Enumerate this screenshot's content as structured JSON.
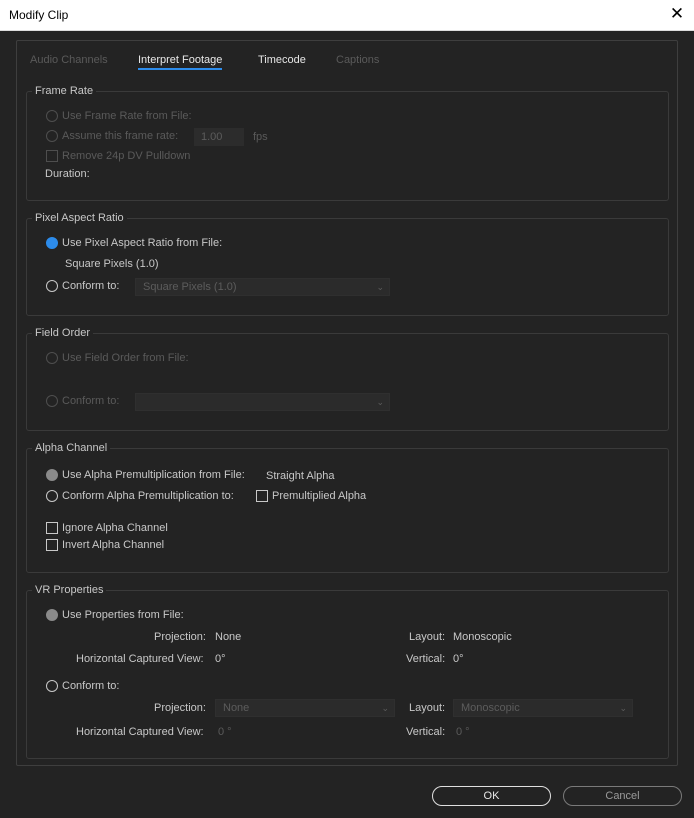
{
  "window": {
    "title": "Modify Clip",
    "close_glyph": "✕"
  },
  "tabs": [
    "Audio Channels",
    "Interpret Footage",
    "Timecode",
    "Captions"
  ],
  "frame_rate": {
    "title": "Frame Rate",
    "use_from_file": "Use Frame Rate from File:",
    "assume_label": "Assume this frame rate:",
    "assume_value": "1.00",
    "fps": "fps",
    "remove_pulldown": "Remove 24p DV Pulldown",
    "duration": "Duration:"
  },
  "pixel_aspect": {
    "title": "Pixel Aspect Ratio",
    "use_from_file": "Use Pixel Aspect Ratio from File:",
    "file_value": "Square Pixels (1.0)",
    "conform_to": "Conform to:",
    "conform_value": "Square Pixels (1.0)"
  },
  "field_order": {
    "title": "Field Order",
    "use_from_file": "Use Field Order from File:",
    "conform_to": "Conform to:",
    "conform_value": ""
  },
  "alpha": {
    "title": "Alpha Channel",
    "use_premult": "Use Alpha Premultiplication from File:",
    "premult_value": "Straight Alpha",
    "conform_premult": "Conform Alpha Premultiplication to:",
    "premultiplied": "Premultiplied Alpha",
    "ignore": "Ignore Alpha Channel",
    "invert": "Invert Alpha Channel"
  },
  "vr": {
    "title": "VR Properties",
    "use_from_file": "Use Properties from File:",
    "projection_label": "Projection:",
    "projection_value": "None",
    "layout_label": "Layout:",
    "layout_value": "Monoscopic",
    "hview_label": "Horizontal Captured View:",
    "hview_value": "0°",
    "vertical_label": "Vertical:",
    "vertical_value": "0°",
    "conform_to": "Conform to:",
    "conform_projection": "None",
    "conform_layout": "Monoscopic",
    "conform_hview": "0 °",
    "conform_vertical": "0 °"
  },
  "buttons": {
    "ok": "OK",
    "cancel": "Cancel"
  },
  "icons": {
    "chevron": "chevron-down-icon",
    "close": "close-icon"
  },
  "colors": {
    "accent": "#2d8ceb",
    "background": "#232323"
  }
}
